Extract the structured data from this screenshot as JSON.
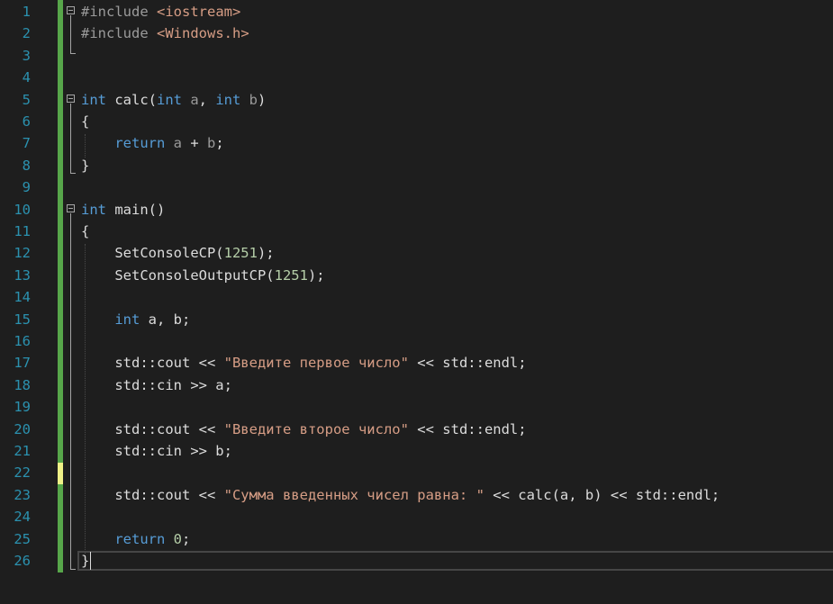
{
  "editor": {
    "language": "cpp",
    "current_line": 26,
    "lines": [
      {
        "n": "1",
        "tokens": [
          {
            "t": "#include ",
            "c": "inc"
          },
          {
            "t": "<iostream>",
            "c": "str"
          }
        ]
      },
      {
        "n": "2",
        "tokens": [
          {
            "t": "#include ",
            "c": "inc"
          },
          {
            "t": "<Windows.h>",
            "c": "str"
          }
        ]
      },
      {
        "n": "3",
        "tokens": []
      },
      {
        "n": "4",
        "tokens": []
      },
      {
        "n": "5",
        "tokens": [
          {
            "t": "int",
            "c": "kw"
          },
          {
            "t": " calc(",
            "c": "fn"
          },
          {
            "t": "int",
            "c": "kw"
          },
          {
            "t": " a",
            "c": "prm"
          },
          {
            "t": ", ",
            "c": "fn"
          },
          {
            "t": "int",
            "c": "kw"
          },
          {
            "t": " b",
            "c": "prm"
          },
          {
            "t": ")",
            "c": "fn"
          }
        ]
      },
      {
        "n": "6",
        "tokens": [
          {
            "t": "{",
            "c": "fn"
          }
        ]
      },
      {
        "n": "7",
        "tokens": [
          {
            "t": "    ",
            "c": "fn"
          },
          {
            "t": "return",
            "c": "kw"
          },
          {
            "t": " a",
            "c": "prm"
          },
          {
            "t": " + ",
            "c": "fn"
          },
          {
            "t": "b",
            "c": "prm"
          },
          {
            "t": ";",
            "c": "fn"
          }
        ]
      },
      {
        "n": "8",
        "tokens": [
          {
            "t": "}",
            "c": "fn"
          }
        ]
      },
      {
        "n": "9",
        "tokens": []
      },
      {
        "n": "10",
        "tokens": [
          {
            "t": "int",
            "c": "kw"
          },
          {
            "t": " main()",
            "c": "fn"
          }
        ]
      },
      {
        "n": "11",
        "tokens": [
          {
            "t": "{",
            "c": "fn"
          }
        ]
      },
      {
        "n": "12",
        "tokens": [
          {
            "t": "    SetConsoleCP(",
            "c": "fn"
          },
          {
            "t": "1251",
            "c": "num"
          },
          {
            "t": ");",
            "c": "fn"
          }
        ]
      },
      {
        "n": "13",
        "tokens": [
          {
            "t": "    SetConsoleOutputCP(",
            "c": "fn"
          },
          {
            "t": "1251",
            "c": "num"
          },
          {
            "t": ");",
            "c": "fn"
          }
        ]
      },
      {
        "n": "14",
        "tokens": []
      },
      {
        "n": "15",
        "tokens": [
          {
            "t": "    ",
            "c": "fn"
          },
          {
            "t": "int",
            "c": "kw"
          },
          {
            "t": " a, b;",
            "c": "fn"
          }
        ]
      },
      {
        "n": "16",
        "tokens": []
      },
      {
        "n": "17",
        "tokens": [
          {
            "t": "    std::cout << ",
            "c": "fn"
          },
          {
            "t": "\"Введите первое число\"",
            "c": "str"
          },
          {
            "t": " << std::endl;",
            "c": "fn"
          }
        ]
      },
      {
        "n": "18",
        "tokens": [
          {
            "t": "    std::cin >> a;",
            "c": "fn"
          }
        ]
      },
      {
        "n": "19",
        "tokens": []
      },
      {
        "n": "20",
        "tokens": [
          {
            "t": "    std::cout << ",
            "c": "fn"
          },
          {
            "t": "\"Введите второе число\"",
            "c": "str"
          },
          {
            "t": " << std::endl;",
            "c": "fn"
          }
        ]
      },
      {
        "n": "21",
        "tokens": [
          {
            "t": "    std::cin >> b;",
            "c": "fn"
          }
        ]
      },
      {
        "n": "22",
        "tokens": []
      },
      {
        "n": "23",
        "tokens": [
          {
            "t": "    std::cout << ",
            "c": "fn"
          },
          {
            "t": "\"Сумма введенных чисел равна: \"",
            "c": "str"
          },
          {
            "t": " << calc(a, b) << std::endl;",
            "c": "fn"
          }
        ]
      },
      {
        "n": "24",
        "tokens": []
      },
      {
        "n": "25",
        "tokens": [
          {
            "t": "    ",
            "c": "fn"
          },
          {
            "t": "return",
            "c": "kw"
          },
          {
            "t": " ",
            "c": "fn"
          },
          {
            "t": "0",
            "c": "num"
          },
          {
            "t": ";",
            "c": "fn"
          }
        ]
      },
      {
        "n": "26",
        "tokens": [
          {
            "t": "}",
            "c": "fn"
          }
        ]
      }
    ]
  }
}
